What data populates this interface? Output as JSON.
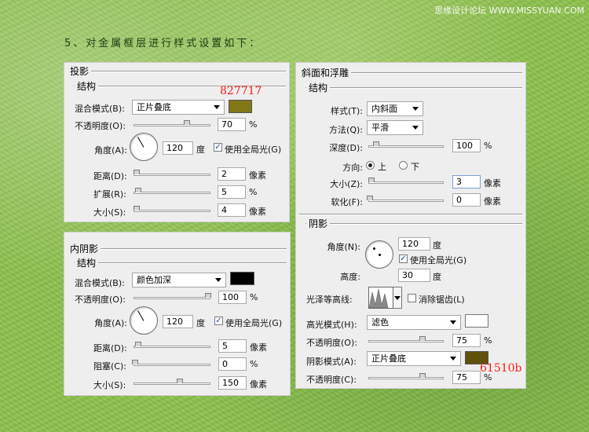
{
  "watermark": "思缘设计论坛 WWW.MISSYUAN.COM",
  "heading": "5、对金属框层进行样式设置如下：",
  "drop_shadow": {
    "title": "投影",
    "section": "结构",
    "blend_label": "混合模式(B):",
    "blend_value": "正片叠底",
    "color": "#827717",
    "color_note": "827717",
    "opacity_label": "不透明度(O):",
    "opacity_value": "70",
    "opacity_unit": "%",
    "angle_label": "角度(A):",
    "angle_value": "120",
    "angle_unit": "度",
    "global_light_label": "使用全局光(G)",
    "distance_label": "距离(D):",
    "distance_value": "2",
    "distance_unit": "像素",
    "spread_label": "扩展(R):",
    "spread_value": "5",
    "spread_unit": "%",
    "size_label": "大小(S):",
    "size_value": "4",
    "size_unit": "像素"
  },
  "inner_shadow": {
    "title": "内阴影",
    "section": "结构",
    "blend_label": "混合模式(B):",
    "blend_value": "颜色加深",
    "color": "#000000",
    "opacity_label": "不透明度(O):",
    "opacity_value": "100",
    "opacity_unit": "%",
    "angle_label": "角度(A):",
    "angle_value": "120",
    "angle_unit": "度",
    "global_light_label": "使用全局光(G)",
    "distance_label": "距离(D):",
    "distance_value": "5",
    "distance_unit": "像素",
    "choke_label": "阻塞(C):",
    "choke_value": "0",
    "choke_unit": "%",
    "size_label": "大小(S):",
    "size_value": "150",
    "size_unit": "像素"
  },
  "bevel": {
    "title": "斜面和浮雕",
    "section": "结构",
    "style_label": "样式(T):",
    "style_value": "内斜面",
    "technique_label": "方法(Q):",
    "technique_value": "平滑",
    "depth_label": "深度(D):",
    "depth_value": "100",
    "depth_unit": "%",
    "direction_label": "方向:",
    "direction_up": "上",
    "direction_down": "下",
    "size_label": "大小(Z):",
    "size_value": "3",
    "size_unit": "像素",
    "soften_label": "软化(F):",
    "soften_value": "0",
    "soften_unit": "像素"
  },
  "shading": {
    "section": "阴影",
    "angle_label": "角度(N):",
    "angle_value": "120",
    "angle_unit": "度",
    "global_light_label": "使用全局光(G)",
    "altitude_label": "高度:",
    "altitude_value": "30",
    "altitude_unit": "度",
    "gloss_label": "光泽等高线:",
    "antialias_label": "消除锯齿(L)",
    "highlight_label": "高光模式(H):",
    "highlight_value": "滤色",
    "highlight_color": "#ffffff",
    "highlight_opacity_label": "不透明度(O):",
    "highlight_opacity_value": "75",
    "highlight_opacity_unit": "%",
    "shadow_label": "阴影模式(A):",
    "shadow_value": "正片叠底",
    "shadow_color": "#61510b",
    "shadow_color_note": "61510b",
    "shadow_opacity_label": "不透明度(C):",
    "shadow_opacity_value": "75",
    "shadow_opacity_unit": "%"
  }
}
